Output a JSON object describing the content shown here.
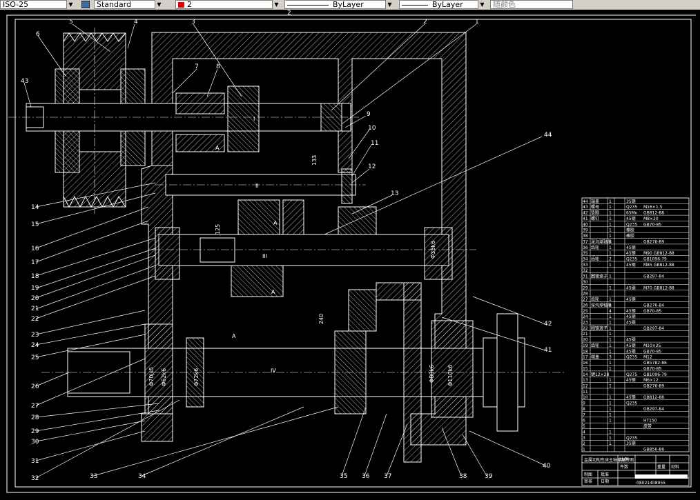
{
  "toolbar": {
    "dimstyle": "ISO-25",
    "textstyle": "Standard",
    "layer": "2",
    "linetype": "ByLayer",
    "lineweight": "ByLayer",
    "plotstyle": "随颜色"
  },
  "drawing": {
    "top_label": "2",
    "balloons_top": [
      "5",
      "4",
      "3",
      "2",
      "1"
    ],
    "balloons_left": [
      "6",
      "43",
      "7",
      "8",
      "14",
      "15",
      "16",
      "17",
      "18",
      "19",
      "20",
      "21",
      "22",
      "23",
      "24",
      "25",
      "26",
      "27",
      "28",
      "29",
      "30",
      "31",
      "32"
    ],
    "balloons_right": [
      "9",
      "10",
      "11",
      "12",
      "13",
      "44",
      "42",
      "41",
      "40",
      "39",
      "38",
      "37",
      "36",
      "35",
      "34",
      "33"
    ],
    "shaft_labels": [
      "I",
      "II",
      "III",
      "IV"
    ],
    "section_marks": [
      "A",
      "A",
      "A",
      "A"
    ],
    "dims": [
      "Φ70js5",
      "Φ62k6",
      "Φ72k6",
      "Φ80k6",
      "Φ110k6",
      "Φ35k6",
      "240",
      "125",
      "133"
    ],
    "title_block": {
      "title": "金属切削车床主轴箱展开图",
      "drawing_no": "08021408955",
      "rows": [
        "制图",
        "审核",
        "批准",
        "日期"
      ],
      "cols": [
        "比例",
        "件数",
        "重量",
        "材料"
      ]
    },
    "bom": [
      {
        "no": "44",
        "name": "端盖",
        "qty": "1",
        "mat": "35钢",
        "std": ""
      },
      {
        "no": "43",
        "name": "螺母",
        "qty": "1",
        "mat": "Q235",
        "std": "M16×1.5"
      },
      {
        "no": "42",
        "name": "垫圈",
        "qty": "1",
        "mat": "65Mn",
        "std": "GB812-88"
      },
      {
        "no": "41",
        "name": "螺钉",
        "qty": "1",
        "mat": "45钢",
        "std": "M8×20"
      },
      {
        "no": "40",
        "name": "",
        "qty": "1",
        "mat": "Q235",
        "std": "GB70-85"
      },
      {
        "no": "39",
        "name": "",
        "qty": "1",
        "mat": "橡胶",
        "std": ""
      },
      {
        "no": "38",
        "name": "",
        "qty": "1",
        "mat": "橡胶",
        "std": ""
      },
      {
        "no": "37",
        "name": "深沟球轴承",
        "qty": "1",
        "mat": "",
        "std": "GB276-89"
      },
      {
        "no": "36",
        "name": "齿轮",
        "qty": "1",
        "mat": "45钢",
        "std": ""
      },
      {
        "no": "35",
        "name": "",
        "qty": "1",
        "mat": "45钢",
        "std": "M90 GB812-88"
      },
      {
        "no": "34",
        "name": "齿轮",
        "qty": "2",
        "mat": "Q235",
        "std": "GB1096-79"
      },
      {
        "no": "33",
        "name": "",
        "qty": "1",
        "mat": "45钢",
        "std": "M85 GB812-88"
      },
      {
        "no": "32",
        "name": "",
        "qty": "",
        "mat": "",
        "std": ""
      },
      {
        "no": "31",
        "name": "圆锥滚子",
        "qty": "1",
        "mat": "",
        "std": "GB297-84"
      },
      {
        "no": "30",
        "name": "",
        "qty": "",
        "mat": "",
        "std": ""
      },
      {
        "no": "29",
        "name": "",
        "qty": "1",
        "mat": "45钢",
        "std": "M70 GB812-88"
      },
      {
        "no": "28",
        "name": "",
        "qty": "",
        "mat": "",
        "std": ""
      },
      {
        "no": "27",
        "name": "齿轮",
        "qty": "1",
        "mat": "45钢",
        "std": ""
      },
      {
        "no": "26",
        "name": "深沟球轴承",
        "qty": "1",
        "mat": "",
        "std": "GB276-84"
      },
      {
        "no": "25",
        "name": "",
        "qty": "4",
        "mat": "45钢",
        "std": "GB70-85"
      },
      {
        "no": "24",
        "name": "",
        "qty": "1",
        "mat": "45钢",
        "std": ""
      },
      {
        "no": "23",
        "name": "",
        "qty": "1",
        "mat": "45钢",
        "std": ""
      },
      {
        "no": "22",
        "name": "圆锥滚子",
        "qty": "1",
        "mat": "",
        "std": "GB297-84"
      },
      {
        "no": "21",
        "name": "",
        "qty": "1",
        "mat": "",
        "std": ""
      },
      {
        "no": "20",
        "name": "",
        "qty": "1",
        "mat": "45钢",
        "std": ""
      },
      {
        "no": "19",
        "name": "齿轮",
        "qty": "1",
        "mat": "45钢",
        "std": "M10×25"
      },
      {
        "no": "18",
        "name": "",
        "qty": "1",
        "mat": "45钢",
        "std": "GB70-85"
      },
      {
        "no": "17",
        "name": "端盖",
        "qty": "3",
        "mat": "Q235",
        "std": "M12"
      },
      {
        "no": "16",
        "name": "",
        "qty": "1",
        "mat": "",
        "std": "GB5782-86"
      },
      {
        "no": "15",
        "name": "",
        "qty": "1",
        "mat": "",
        "std": "GB70-85"
      },
      {
        "no": "14",
        "name": "键12×28",
        "qty": "",
        "mat": "Q275",
        "std": "GB1096-79"
      },
      {
        "no": "13",
        "name": "",
        "qty": "1",
        "mat": "45钢",
        "std": "M6×12"
      },
      {
        "no": "12",
        "name": "",
        "qty": "1",
        "mat": "",
        "std": "GB276-89"
      },
      {
        "no": "11",
        "name": "",
        "qty": "",
        "mat": "",
        "std": ""
      },
      {
        "no": "10",
        "name": "",
        "qty": "1",
        "mat": "45钢",
        "std": "GB812-88"
      },
      {
        "no": "9",
        "name": "",
        "qty": "1",
        "mat": "Q235",
        "std": ""
      },
      {
        "no": "8",
        "name": "",
        "qty": "1",
        "mat": "",
        "std": "GB297-84"
      },
      {
        "no": "7",
        "name": "",
        "qty": "1",
        "mat": "",
        "std": ""
      },
      {
        "no": "6",
        "name": "",
        "qty": "1",
        "mat": "",
        "std": "HT150"
      },
      {
        "no": "5",
        "name": "",
        "qty": "",
        "mat": "",
        "std": "皮带"
      },
      {
        "no": "4",
        "name": "",
        "qty": "1",
        "mat": "",
        "std": ""
      },
      {
        "no": "3",
        "name": "",
        "qty": "1",
        "mat": "Q235",
        "std": ""
      },
      {
        "no": "2",
        "name": "",
        "qty": "1",
        "mat": "35钢",
        "std": ""
      },
      {
        "no": "1",
        "name": "",
        "qty": "",
        "mat": "",
        "std": "GB856-86"
      }
    ]
  }
}
